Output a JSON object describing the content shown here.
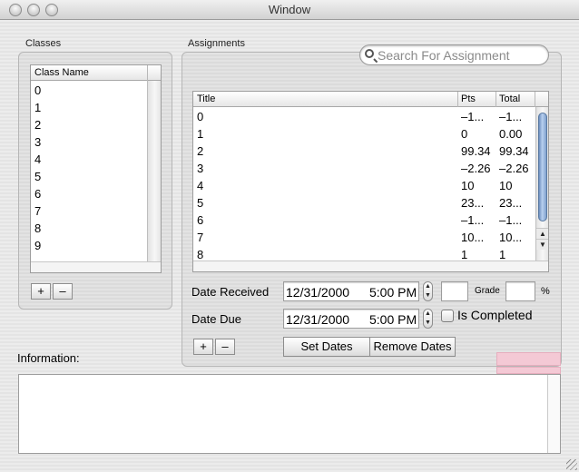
{
  "window": {
    "title": "Window"
  },
  "classes": {
    "group_label": "Classes",
    "column_header": "Class Name",
    "items": [
      "0",
      "1",
      "2",
      "3",
      "4",
      "5",
      "6",
      "7",
      "8",
      "9"
    ],
    "add_label": "+",
    "remove_label": "–"
  },
  "assignments": {
    "group_label": "Assignments",
    "search_placeholder": "Search For Assignment",
    "columns": {
      "title": "Title",
      "pts": "Pts",
      "total": "Total"
    },
    "rows": [
      {
        "title": "0",
        "pts": "–1...",
        "total": "–1..."
      },
      {
        "title": "1",
        "pts": "0",
        "total": "0.00"
      },
      {
        "title": "2",
        "pts": "99.34",
        "total": "99.34"
      },
      {
        "title": "3",
        "pts": "–2.26",
        "total": "–2.26"
      },
      {
        "title": "4",
        "pts": "10",
        "total": "10"
      },
      {
        "title": "5",
        "pts": "23...",
        "total": "23..."
      },
      {
        "title": "6",
        "pts": "–1...",
        "total": "–1..."
      },
      {
        "title": "7",
        "pts": "10...",
        "total": "10..."
      },
      {
        "title": "8",
        "pts": "1",
        "total": "1"
      }
    ],
    "date_received_label": "Date Received",
    "date_received_value": "12/31/2000",
    "date_received_time": "5:00 PM",
    "date_due_label": "Date Due",
    "date_due_value": "12/31/2000",
    "date_due_time": "5:00 PM",
    "grade_label": "Grade",
    "percent_label": "%",
    "completed_label": "Is Completed",
    "add_label": "+",
    "remove_label": "–",
    "set_dates_label": "Set Dates",
    "remove_dates_label": "Remove Dates"
  },
  "information": {
    "label": "Information:"
  },
  "icons": {
    "up": "▲",
    "down": "▼"
  }
}
